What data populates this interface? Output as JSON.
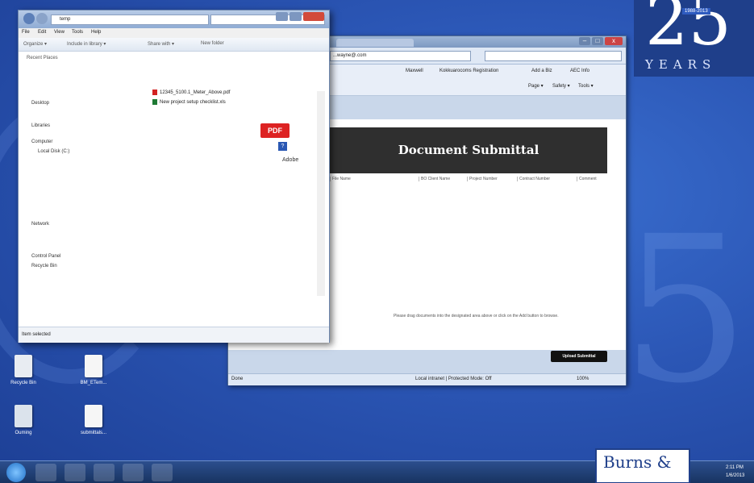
{
  "logo": {
    "number": "25",
    "years": "YEARS",
    "dates": "1988-2013"
  },
  "explorer": {
    "address": "temp",
    "menu": [
      "File",
      "Edit",
      "View",
      "Tools",
      "Help"
    ],
    "toolbar": [
      "Organize ▾",
      "Include in library ▾",
      "Share with ▾",
      "New folder"
    ],
    "recent": "Recent Places",
    "tree": [
      "Desktop",
      "Libraries",
      "Computer",
      "Local Disk (C:)",
      "Network",
      "Control Panel",
      "Recycle Bin"
    ],
    "files": [
      {
        "name": "12345_5100.1_Meter_Above.pdf",
        "color": "#d22222"
      },
      {
        "name": "New project setup checklist.xls",
        "color": "#1e7a34"
      }
    ],
    "preview_pdf": "PDF",
    "preview_brand": "Adobe",
    "status": "Item selected"
  },
  "browser": {
    "address": "...wayne@.com",
    "favorites": [
      "Maxwell",
      "Kokkuarocoms Registration",
      "Add a Biz",
      "AEC Info"
    ],
    "commands": [
      "Page ▾",
      "Safety ▾",
      "Tools ▾"
    ],
    "header": "Document Submittal",
    "columns": [
      "File Name",
      "BO Client Name",
      "Project Number",
      "Contract Number",
      "Comment"
    ],
    "hint": "Please drag documents into the designated area above or click on the Add button to browse.",
    "upload_button": "Upload Submittal",
    "status_left": "Done",
    "status_mid": "Local intranet | Protected Mode: Off",
    "status_zoom": "100%"
  },
  "desktop_icons": [
    {
      "label": "Recycle Bin"
    },
    {
      "label": "BM_ETem..."
    },
    {
      "label": "Ouming"
    },
    {
      "label": "submittals..."
    }
  ],
  "taskbar": {
    "brand": "Burns &",
    "time": "2:11 PM",
    "date": "1/6/2013"
  }
}
